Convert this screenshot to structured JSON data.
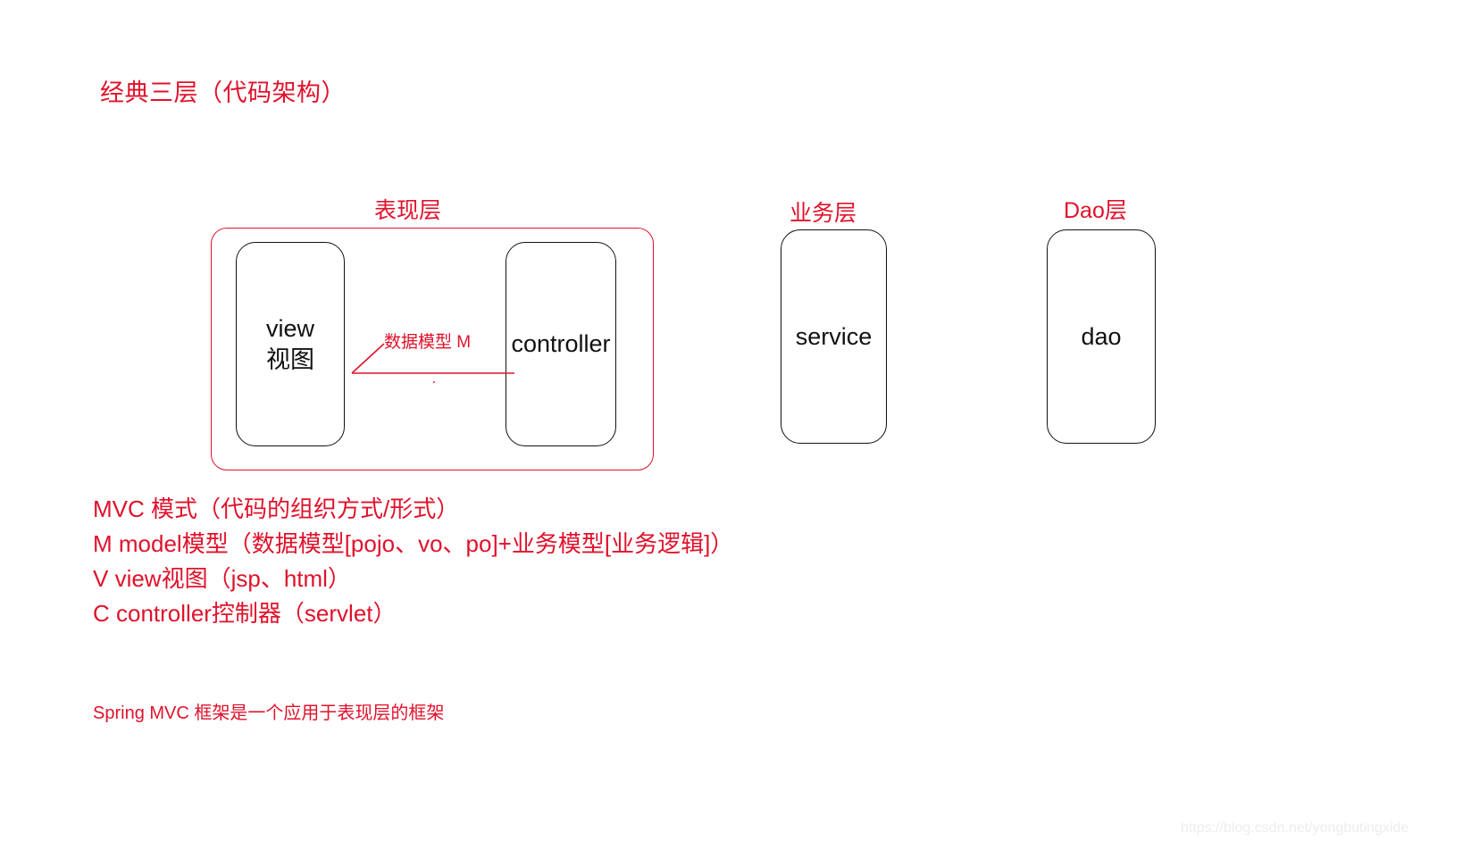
{
  "title": "经典三层（代码架构）",
  "layers": [
    {
      "id": "presentation",
      "caption": "表现层"
    },
    {
      "id": "business",
      "caption": "业务层"
    },
    {
      "id": "dao",
      "caption": "Dao层"
    }
  ],
  "boxes": {
    "view": "view\n视图",
    "controller": "controller",
    "service": "service",
    "dao": "dao"
  },
  "arrow": {
    "label": "数据模型 M",
    "from": "controller",
    "to": "view",
    "direction": "left"
  },
  "mvc_notes": [
    "MVC 模式（代码的组织方式/形式）",
    "M model模型（数据模型[pojo、vo、po]+业务模型[业务逻辑]）",
    "V  view视图（jsp、html）",
    "C  controller控制器（servlet）"
  ],
  "footer_note": "Spring MVC 框架是一个应用于表现层的框架",
  "watermark": "https://blog.csdn.net/yongbutingxide",
  "colors": {
    "accent_red": "#e0122b",
    "box_stroke": "#111111",
    "background": "#ffffff",
    "watermark": "#ededed"
  }
}
